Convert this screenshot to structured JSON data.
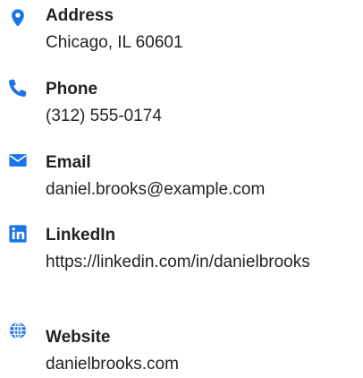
{
  "accent_color": "#1a73e8",
  "contacts": [
    {
      "icon": "location-pin-icon",
      "label": "Address",
      "value": "Chicago, IL 60601"
    },
    {
      "icon": "phone-icon",
      "label": "Phone",
      "value": "(312) 555-0174"
    },
    {
      "icon": "envelope-icon",
      "label": "Email",
      "value": "daniel.brooks@example.com"
    },
    {
      "icon": "linkedin-icon",
      "label": "LinkedIn",
      "value": "https://linkedin.com/in/danielbrooks"
    },
    {
      "icon": "globe-icon",
      "label": "Website",
      "value": "danielbrooks.com"
    }
  ]
}
